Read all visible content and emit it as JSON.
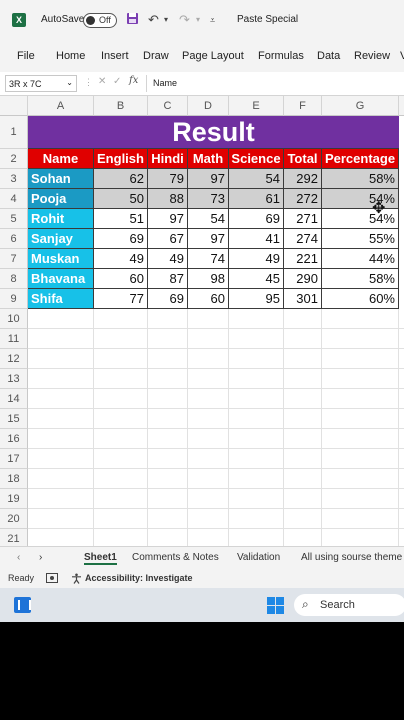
{
  "titlebar": {
    "logo": "X",
    "autosave_label": "AutoSave",
    "toggle_state": "Off",
    "paste_special": "Paste Special",
    "icons": [
      "save-icon",
      "undo-icon",
      "redo-icon",
      "customize-icon"
    ]
  },
  "ribbon": {
    "tabs": [
      "File",
      "Home",
      "Insert",
      "Draw",
      "Page Layout",
      "Formulas",
      "Data",
      "Review",
      "V"
    ]
  },
  "formula_bar": {
    "name_box": "3R x 7C",
    "fx": "fx",
    "content": "Name"
  },
  "columns": [
    "A",
    "B",
    "C",
    "D",
    "E",
    "F",
    "G"
  ],
  "rows": [
    "1",
    "2",
    "3",
    "4",
    "5",
    "6",
    "7",
    "8",
    "9",
    "10",
    "11",
    "12",
    "13",
    "14",
    "15",
    "16",
    "17",
    "18",
    "19",
    "20",
    "21"
  ],
  "table": {
    "title": "Result",
    "headers": [
      "Name",
      "English",
      "Hindi",
      "Math",
      "Science",
      "Total",
      "Percentage"
    ],
    "records": [
      [
        "Sohan",
        "62",
        "79",
        "97",
        "54",
        "292",
        "58%"
      ],
      [
        "Pooja",
        "50",
        "88",
        "73",
        "61",
        "272",
        "54%"
      ],
      [
        "Rohit",
        "51",
        "97",
        "54",
        "69",
        "271",
        "54%"
      ],
      [
        "Sanjay",
        "69",
        "67",
        "97",
        "41",
        "274",
        "55%"
      ],
      [
        "Muskan",
        "49",
        "49",
        "74",
        "49",
        "221",
        "44%"
      ],
      [
        "Bhavana",
        "60",
        "87",
        "98",
        "45",
        "290",
        "58%"
      ],
      [
        "Shifa",
        "77",
        "69",
        "60",
        "95",
        "301",
        "60%"
      ]
    ],
    "colors": {
      "title_bg": "#7030a0",
      "header_bg": "#e00000",
      "name_bg": "#17c1e8",
      "selected_bg": "#d0d0d0"
    }
  },
  "sheet_tabs": {
    "tabs": [
      "Sheet1",
      "Comments & Notes",
      "Validation",
      "All using sourse theme c"
    ],
    "active": "Sheet1"
  },
  "status": {
    "ready": "Ready",
    "accessibility": "Accessibility: Investigate"
  },
  "taskbar": {
    "search_label": "Search"
  }
}
